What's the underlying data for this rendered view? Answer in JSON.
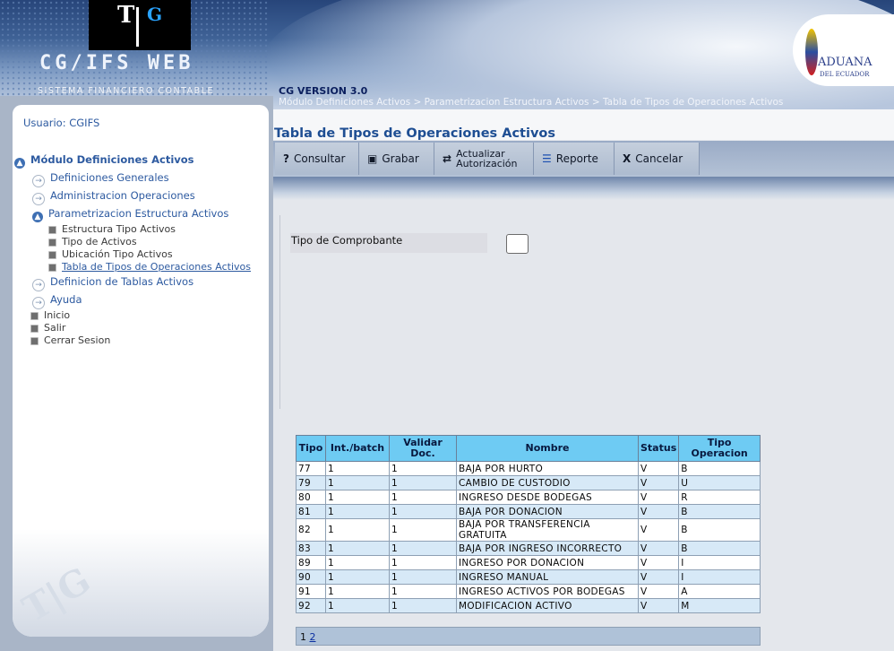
{
  "header": {
    "logo_letters": [
      "T",
      "G"
    ],
    "app_name": "CG/IFS WEB",
    "app_subtitle": "SISTEMA FINANCIERO CONTABLE",
    "version": "CG VERSION 3.0",
    "breadcrumb": "Módulo Definiciones Activos > Parametrizacion Estructura Activos > Tabla de Tipos de Operaciones Activos",
    "partner_logo": {
      "name": "ADUANA",
      "sub": "DEL ECUADOR"
    }
  },
  "sidebar": {
    "user": "Usuario: CGIFS",
    "module": "Módulo Definiciones Activos",
    "items": [
      {
        "label": "Definiciones Generales"
      },
      {
        "label": "Administracion Operaciones"
      },
      {
        "label": "Parametrizacion Estructura Activos"
      },
      {
        "label": "Estructura Tipo Activos"
      },
      {
        "label": "Tipo de Activos"
      },
      {
        "label": "Ubicación Tipo Activos"
      },
      {
        "label": "Tabla de Tipos de Operaciones Activos"
      },
      {
        "label": "Definicion de Tablas Activos"
      },
      {
        "label": "Ayuda"
      },
      {
        "label": "Inicio"
      },
      {
        "label": "Salir"
      },
      {
        "label": "Cerrar Sesion"
      }
    ],
    "watermark": "T|G"
  },
  "page": {
    "title": "Tabla de Tipos de Operaciones Activos"
  },
  "toolbar": {
    "consultar": "Consultar",
    "grabar": "Grabar",
    "actualizar_line1": "Actualizar",
    "actualizar_line2": "Autorización",
    "reporte": "Reporte",
    "cancelar": "Cancelar"
  },
  "form": {
    "tipo_comprobante_label": "Tipo de Comprobante",
    "tipo_comprobante_value": ""
  },
  "table": {
    "headers": [
      "Tipo",
      "Int./batch",
      "Validar Doc.",
      "Nombre",
      "Status",
      "Tipo Operacion"
    ],
    "rows": [
      [
        "77",
        "1",
        "1",
        "BAJA POR HURTO",
        "V",
        "B"
      ],
      [
        "79",
        "1",
        "1",
        "CAMBIO DE CUSTODIO",
        "V",
        "U"
      ],
      [
        "80",
        "1",
        "1",
        "INGRESO DESDE BODEGAS",
        "V",
        "R"
      ],
      [
        "81",
        "1",
        "1",
        "BAJA POR DONACION",
        "V",
        "B"
      ],
      [
        "82",
        "1",
        "1",
        "BAJA POR TRANSFERENCIA GRATUITA",
        "V",
        "B"
      ],
      [
        "83",
        "1",
        "1",
        "BAJA POR INGRESO INCORRECTO",
        "V",
        "B"
      ],
      [
        "89",
        "1",
        "1",
        "INGRESO POR DONACION",
        "V",
        "I"
      ],
      [
        "90",
        "1",
        "1",
        "INGRESO MANUAL",
        "V",
        "I"
      ],
      [
        "91",
        "1",
        "1",
        "INGRESO ACTIVOS POR BODEGAS",
        "V",
        "A"
      ],
      [
        "92",
        "1",
        "1",
        "MODIFICACION ACTIVO",
        "V",
        "M"
      ]
    ],
    "pager": {
      "current": "1",
      "next": "2"
    }
  }
}
